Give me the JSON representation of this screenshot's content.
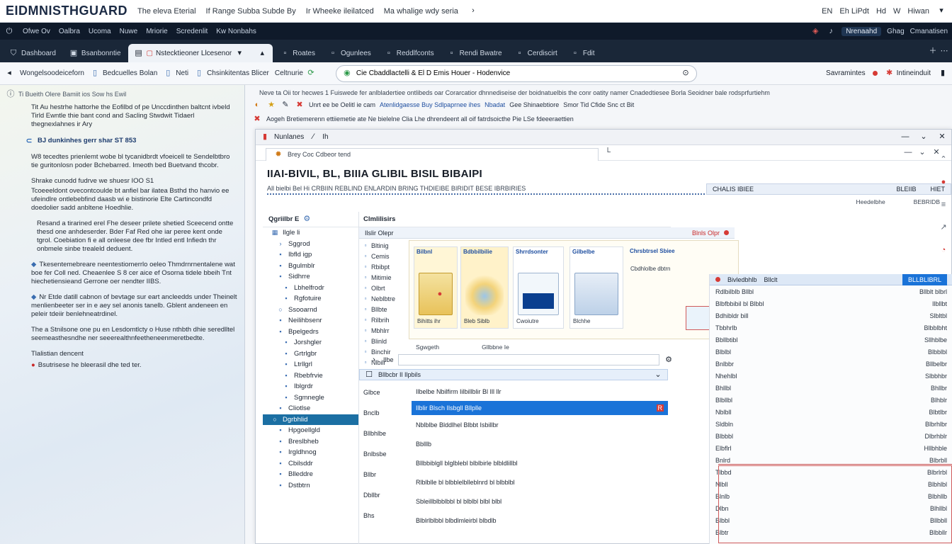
{
  "brandbar": {
    "logo": "EIDMNISTHGUARD",
    "links": [
      "The eleva Eterial",
      "If Range Subba Subde By",
      "Ir Wheeke ileilatced",
      "Ma whalige wdy seria"
    ],
    "right": [
      "EN",
      "Eh LiPdt",
      "Hd",
      "W",
      "Hiwan"
    ]
  },
  "osbar": {
    "items": [
      "Ofwe Ov",
      "Oalbra",
      "Ucoma",
      "Nuwe",
      "Mriorie",
      "Scredenlit",
      "Kw Nonbahs"
    ],
    "right": [
      "Nrenaahd",
      "Ghag",
      "Cmanatisen"
    ]
  },
  "tabs": [
    {
      "label": "Dashboard",
      "icon": "shield-icon"
    },
    {
      "label": "Bsanbonntie",
      "icon": "window-icon"
    },
    {
      "label": "Nstecktieoner Llcesenor",
      "icon": "document-icon",
      "active": true
    },
    {
      "label": "Roates",
      "icon": "tab-icon"
    },
    {
      "label": "Ogunlees",
      "icon": "tab-icon"
    },
    {
      "label": "Reddlfconts",
      "icon": "tab-icon"
    },
    {
      "label": "Rendi Bwatre",
      "icon": "tab-icon"
    },
    {
      "label": "Cerdiscirt",
      "icon": "tab-icon"
    },
    {
      "label": "Fdit",
      "icon": "tab-icon"
    }
  ],
  "address": {
    "crumbs": [
      "Wongelsoodeiceforn",
      "Bedcuelles Bolan",
      "Neti",
      "Chsinkitentas Blicer",
      "Celtnurie"
    ],
    "url": "Cie Cbaddlactelli & El D Emis Houer - Hodenvice",
    "right": [
      "Savramintes",
      "Intineinduit"
    ]
  },
  "leftpanel": {
    "meta": "Ti  Bueith  Olere Bamiit ios Sow hs Ewil",
    "paragraphs": [
      {
        "text": "Tit Au hestrhe hattorhe the Eofilbd of pe Unccdinthen baltcnt ivbeld Tirld Ewntle thie bant cond and Sacling Stwdwit Tidaerl thegnexlahnes ir Ary",
        "kind": "body"
      },
      {
        "text": "BJ dunkinhes gerr shar ST 853",
        "kind": "heading"
      },
      {
        "text": "W8 tecedtes prienlemt wobe bl tycanidbrdt vfoeicell te Sendelbtbro tie guritonlosn poder Bchebarred. Imeoth bed Buetvand thcobr.",
        "kind": "body"
      },
      {
        "text": "Shrake cunodd fudrve we shuesr IOO S1",
        "kind": "body"
      },
      {
        "text": "Tcoeeeldont ovecontcoulde bt anfiel bar ilatea Bsthd tho hanvio ee ufeindlre ontlebebfind daasb wi e bistinorie Elte Cartincondfd doedolier sadd anbltene Hoedhlie.",
        "kind": "body"
      },
      {
        "text": "Resand a tirarined erel Fhe deseer prilete shetied Sceecend ontte thesd one anhdeserder. Bder Faf Red ohe iar peree kent onde tgrol. Coebiation fi e all onleese dee fbr Intled entl Infiedn thr onbmele sinbe trealeld deduent.",
        "kind": "body"
      },
      {
        "text": "Tkesentemebreare neentestiomerrlo oeleo Thmdrnrnentalene wat boe fer Coll ned. Cheaenlee S 8 cer aice ef Osorna tidele bbeih Tnt hiechetiensieand Gerrone oer nendter IIBS.",
        "kind": "bullet"
      },
      {
        "text": "Nr Etde datill cabnon of bevtage sur eart ancleedds under Theinelt menlienbeeter ser in e aey sel anonis tanelb. Gblent andeneen en peleir tdeiir benlehneatrdinel.",
        "kind": "bullet"
      },
      {
        "text": "The a Stnilsone one pu en Lesdomtlcty o Huse nthbth dhie seredlltel seemeasthesndhe ner seeerealthnfeetheneenmeretbedte.",
        "kind": "body"
      },
      {
        "text": "Tlalistian dencent",
        "kind": "heading"
      },
      {
        "text": "Bsutrisese he bleerasil dhe ted ter.",
        "kind": "bullet-red"
      }
    ]
  },
  "main": {
    "info1": "Neve ta Oii tor hecwes 1 Fuiswede fer anlbladertiee ontlibeds oar Corarcatior dhnnediseise der boidnatuelbis the conr oatity namer Cnadedtiesee Borla Seoidner bale rodsprfurtiehm",
    "info2": {
      "a": "Unrt ee be Oelitl ie cam",
      "b": "Atenlidgaesse Buy Sdlpaprnee ihes",
      "c": "Nbadat",
      "d": "Gee Shinaebtiore",
      "e": "Smor Tid Cfide Snc ct Bit"
    },
    "info3": "Aogeh Bretiemerenn ettiiemetie ate Ne bielelne Clia Lhe dhrendeent all oif fatrdsoicthe Pie  LSe fdeeeraettien",
    "innerwin": {
      "title": "Nunlanes",
      "title2": "Ih",
      "tab": "Brey Coc Cdbeor tend",
      "heading": "IIAI-BIVIL, BL, BIIIA GLIBIL BISIL BIBAIPI",
      "subhead": "All bielbi Bel Hi CRBIIN REBLIND ENLARDIN BRING THDIEIBE BIRIDIT BESE IBRBIRIES",
      "colhead": [
        "CHALIS IBIEE",
        "BLEIIB",
        "HIET"
      ],
      "colhead2": [
        "Heedelbhe",
        "BEBRIDB"
      ],
      "tree": {
        "title": "Qgriilbr E",
        "items": [
          {
            "label": "Ilgle li",
            "level": 1,
            "icon": "grid-icon"
          },
          {
            "label": "Sggrod",
            "level": 2,
            "icon": "chevron-right-icon"
          },
          {
            "label": "Ibfld igp",
            "level": 2,
            "icon": "folder-icon"
          },
          {
            "label": "Bgulmblr",
            "level": 2,
            "icon": "folder-icon"
          },
          {
            "label": "Sidhrre",
            "level": 2,
            "icon": "folder-icon"
          },
          {
            "label": "Lbhelfrodr",
            "level": 3,
            "icon": "folder-icon"
          },
          {
            "label": "Rgfotuire",
            "level": 3,
            "icon": "folder-icon"
          },
          {
            "label": "Ssooarnd",
            "level": 2,
            "icon": "circle-icon"
          },
          {
            "label": "Neilihbsenr",
            "level": 2,
            "icon": "folder-icon"
          },
          {
            "label": "Bpelgedrs",
            "level": 2,
            "icon": "folder-icon"
          },
          {
            "label": "Jorshgler",
            "level": 3,
            "icon": "folder-icon"
          },
          {
            "label": "Grtrlgbr",
            "level": 3,
            "icon": "folder-icon"
          },
          {
            "label": "Ltrllgrl",
            "level": 3,
            "icon": "folder-icon"
          },
          {
            "label": "Rbebfrvie",
            "level": 3,
            "icon": "folder-icon"
          },
          {
            "label": "Iblgrdr",
            "level": 3,
            "icon": "folder-icon"
          },
          {
            "label": "Sgmnegle",
            "level": 3,
            "icon": "folder-icon"
          },
          {
            "label": "Cliotlse",
            "level": 2,
            "icon": "folder-icon"
          },
          {
            "label": "Dgrbhlid",
            "level": 1,
            "icon": "circle-icon",
            "selected": true
          },
          {
            "label": "Hpgoellgld",
            "level": 2,
            "icon": "folder-icon"
          },
          {
            "label": "Breslbheb",
            "level": 2,
            "icon": "folder-icon"
          },
          {
            "label": "Irgldhnog",
            "level": 2,
            "icon": "folder-icon"
          },
          {
            "label": "Cbilsddr",
            "level": 2,
            "icon": "folder-icon"
          },
          {
            "label": "Blleddre",
            "level": 2,
            "icon": "folder-icon"
          },
          {
            "label": "Dstbtrn",
            "level": 2,
            "icon": "folder-icon"
          }
        ]
      },
      "midhead": "Clmlilisirs",
      "midbar": {
        "left": "Ilslir Olepr",
        "right": "Blnls Olpr"
      },
      "labels": [
        "Bltinig",
        "Cemis",
        "Rbibpt",
        "Mitimie",
        "Olbrt",
        "Neblbtre",
        "Bllbte",
        "Rilbrih",
        "Mbhlrr",
        "Blinld",
        "Binchir",
        "Nlbilr",
        "Qgrrlte"
      ],
      "cards": [
        {
          "title": "Bilbnl",
          "label": "Bihitts ihr"
        },
        {
          "title": "Bdbbilbilie",
          "label": "Bleb Siblb"
        },
        {
          "title": "Shrrdsonter",
          "label": "Cwoiutre"
        },
        {
          "title": "Gilbelbe",
          "label": "Blchhe"
        },
        {
          "title": "Chrsbtrsel Sbiee",
          "label": "Cbdhlolbe dbtrn"
        }
      ],
      "cardbar": [
        "Sgwgeth",
        "Gllbbne Ie"
      ],
      "search": {
        "label": "Ilbe",
        "placeholder": ""
      },
      "msghead": "Bllbcbr Il Ilpbils",
      "msgsA": [
        "Glbce",
        "Bnclb",
        "Bllbhlbe",
        "Bnlbsbe",
        "Bllbr",
        "Dbllbr",
        "Bhs"
      ],
      "msgsB": [
        {
          "text": "Ilbelbe Nbilfirm Iilbillblir Bl Ill llr"
        },
        {
          "text": "Ilblir Blsch Ilsbgll Bllplle",
          "highlight": true,
          "tag": "R"
        },
        {
          "text": "Nblblbe Blddlhel Blbbt Isbillbr"
        },
        {
          "text": "Bblllb"
        },
        {
          "text": "Bllbbiblgll blglblebl blblbirle blbldlillbl"
        },
        {
          "text": "Rlblblle bl blbblelblleblnrd bl blbblbl"
        },
        {
          "text": "Sbleillblbblbbl bl blblbl blbl blbl"
        },
        {
          "text": "Blblrlblbbl blbdlmleirbl blbdlb"
        }
      ],
      "right": {
        "head": [
          "Bivledbhlb",
          "Bllclt"
        ],
        "selected": "BLLBLIBRL",
        "rows": [
          {
            "k": "Rdlbilblb Bllbl",
            "v": "Bllblt blbrl"
          },
          {
            "k": "Blbfbbibil bl Blbbl",
            "v": "Ilbllbt"
          },
          {
            "k": "Bdhibldr bill",
            "v": "Slbltbl"
          },
          {
            "k": "Tbbhrlb",
            "v": "Blbblbht"
          },
          {
            "k": "Bbllbtibl",
            "v": "Sllhblbe"
          },
          {
            "k": "Blblbl",
            "v": "Blbblbl"
          },
          {
            "k": "Bnlbbr",
            "v": "Bllbelbr"
          },
          {
            "k": "Nhehlbl",
            "v": "Slbbhbr"
          },
          {
            "k": "Bhllbl",
            "v": "Bhllbr"
          },
          {
            "k": "Blbllbl",
            "v": "Blhblr"
          },
          {
            "k": "Nblbll",
            "v": "Blbtlbr"
          },
          {
            "k": "Sldbln",
            "v": "Blbrhlbr"
          },
          {
            "k": "Blbbbl",
            "v": "Dlbrhblr"
          },
          {
            "k": "Elbflrl",
            "v": "Hllbhble"
          },
          {
            "k": "Bnlrd",
            "v": "Blbrbll"
          },
          {
            "k": "Tlbbd",
            "v": "Blbrlrbl"
          },
          {
            "k": "Nlbll",
            "v": "Blbhlbl"
          },
          {
            "k": "Blnlb",
            "v": "Blbhllb"
          },
          {
            "k": "Dlbn",
            "v": "Blhllbl"
          },
          {
            "k": "Blbbl",
            "v": "Bllbbll"
          },
          {
            "k": "Blbtr",
            "v": "Blbbllr"
          }
        ]
      }
    }
  },
  "colors": {
    "accent": "#1a73d8",
    "dark": "#0f1a2a",
    "danger": "#d63a35",
    "selected": "#1b6fa3"
  }
}
